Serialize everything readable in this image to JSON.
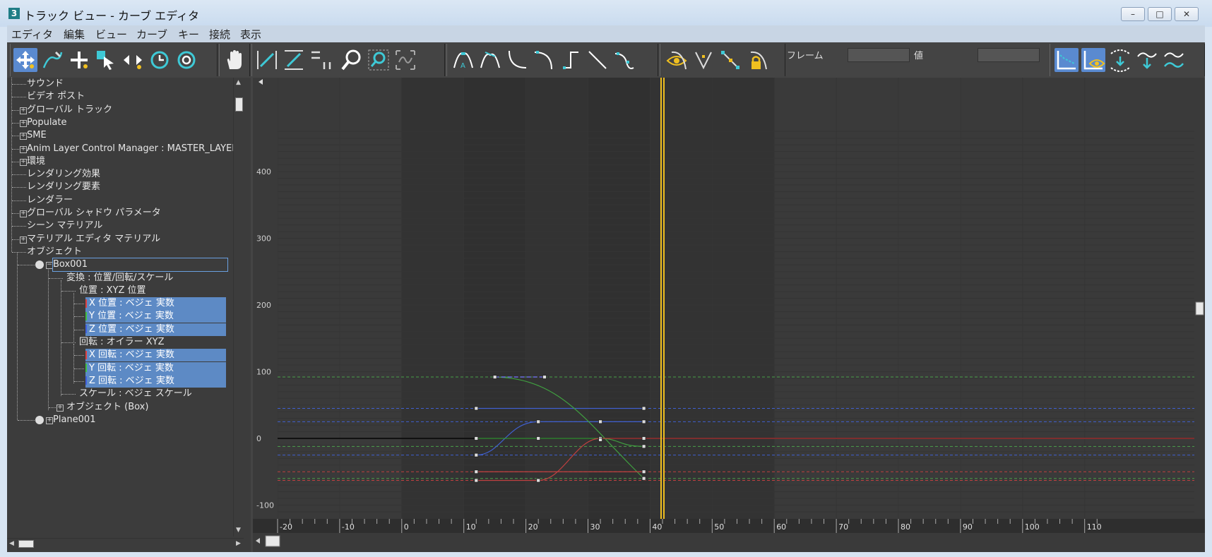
{
  "window": {
    "title": "トラック ビュー - カーブ エディタ",
    "app_icon": "3",
    "controls": {
      "minimize": "–",
      "maximize": "□",
      "close": "✕"
    }
  },
  "menu": [
    "エディタ",
    "編集",
    "ビュー",
    "カーブ",
    "キー",
    "接続",
    "表示"
  ],
  "toolbar": {
    "frame_label": "フレーム",
    "value_label": "値",
    "frame_value": "",
    "value_value": "",
    "icons": [
      "move-keys",
      "draw-curves",
      "add-keys",
      "region-keys",
      "slide-keys",
      "scale-keys-time",
      "scale-values",
      "pan",
      "zoom-horizontal-extents",
      "zoom-value-extents",
      "frame-selection",
      "zoom",
      "zoom-region",
      "isolate-curve",
      "set-tangents-auto",
      "set-tangents-custom",
      "set-tangents-fast",
      "set-tangents-slow",
      "set-tangents-step",
      "set-tangents-linear",
      "set-tangents-smooth",
      "show-tangents",
      "break-tangents",
      "unify-tangents",
      "lock-tangents",
      "filter",
      "show-all-tangents",
      "show-keyable",
      "parameter-curve-out-of-range",
      "ease-curve",
      "multiplier-curve"
    ],
    "colors": {
      "active": "#5a8ad0",
      "accent": "#f0c020",
      "cyan": "#3ec9d6"
    }
  },
  "tree": {
    "items": [
      {
        "label": "サウンド",
        "pm": ""
      },
      {
        "label": "ビデオ ポスト",
        "pm": ""
      },
      {
        "label": "グローバル トラック",
        "pm": "+"
      },
      {
        "label": "Populate",
        "pm": "+"
      },
      {
        "label": "SME",
        "pm": "+"
      },
      {
        "label": "Anim Layer Control Manager : MASTER_LAYER_MANAG",
        "pm": "+"
      },
      {
        "label": "環境",
        "pm": "+"
      },
      {
        "label": "レンダリング効果",
        "pm": ""
      },
      {
        "label": "レンダリング要素",
        "pm": ""
      },
      {
        "label": "レンダラー",
        "pm": ""
      },
      {
        "label": "グローバル シャドウ パラメータ",
        "pm": "+"
      },
      {
        "label": "シーン マテリアル",
        "pm": ""
      },
      {
        "label": "マテリアル エディタ マテリアル",
        "pm": "+"
      },
      {
        "label": "オブジェクト",
        "pm": ""
      },
      {
        "label": "Box001",
        "pm": "−"
      },
      {
        "label": "変換 : 位置/回転/スケール",
        "pm": ""
      },
      {
        "label": "位置 : XYZ 位置",
        "pm": ""
      },
      {
        "label": "X 位置 : ベジェ 実数",
        "pm": ""
      },
      {
        "label": "Y 位置 : ベジェ 実数",
        "pm": ""
      },
      {
        "label": "Z 位置 : ベジェ 実数",
        "pm": ""
      },
      {
        "label": "回転 : オイラー XYZ",
        "pm": ""
      },
      {
        "label": "X 回転 : ベジェ 実数",
        "pm": ""
      },
      {
        "label": "Y 回転 : ベジェ 実数",
        "pm": ""
      },
      {
        "label": "Z 回転 : ベジェ 実数",
        "pm": ""
      },
      {
        "label": "スケール : ベジェ スケール",
        "pm": ""
      },
      {
        "label": "オブジェクト (Box)",
        "pm": "+"
      },
      {
        "label": "Plane001",
        "pm": "+"
      }
    ]
  },
  "graph": {
    "y_ticks": [
      "400",
      "300",
      "200",
      "100",
      "0",
      "-100"
    ],
    "x_ticks": [
      "-20",
      "-10",
      "0",
      "10",
      "20",
      "30",
      "40",
      "50",
      "60",
      "70",
      "80",
      "90",
      "100",
      "110"
    ],
    "current_frame": 42,
    "active_range": [
      0,
      60
    ],
    "colors": {
      "x": "#c04040",
      "y": "#40a040",
      "z": "#4060d0",
      "time_slider": "#f0c020",
      "background": "#3a3a3a"
    }
  }
}
